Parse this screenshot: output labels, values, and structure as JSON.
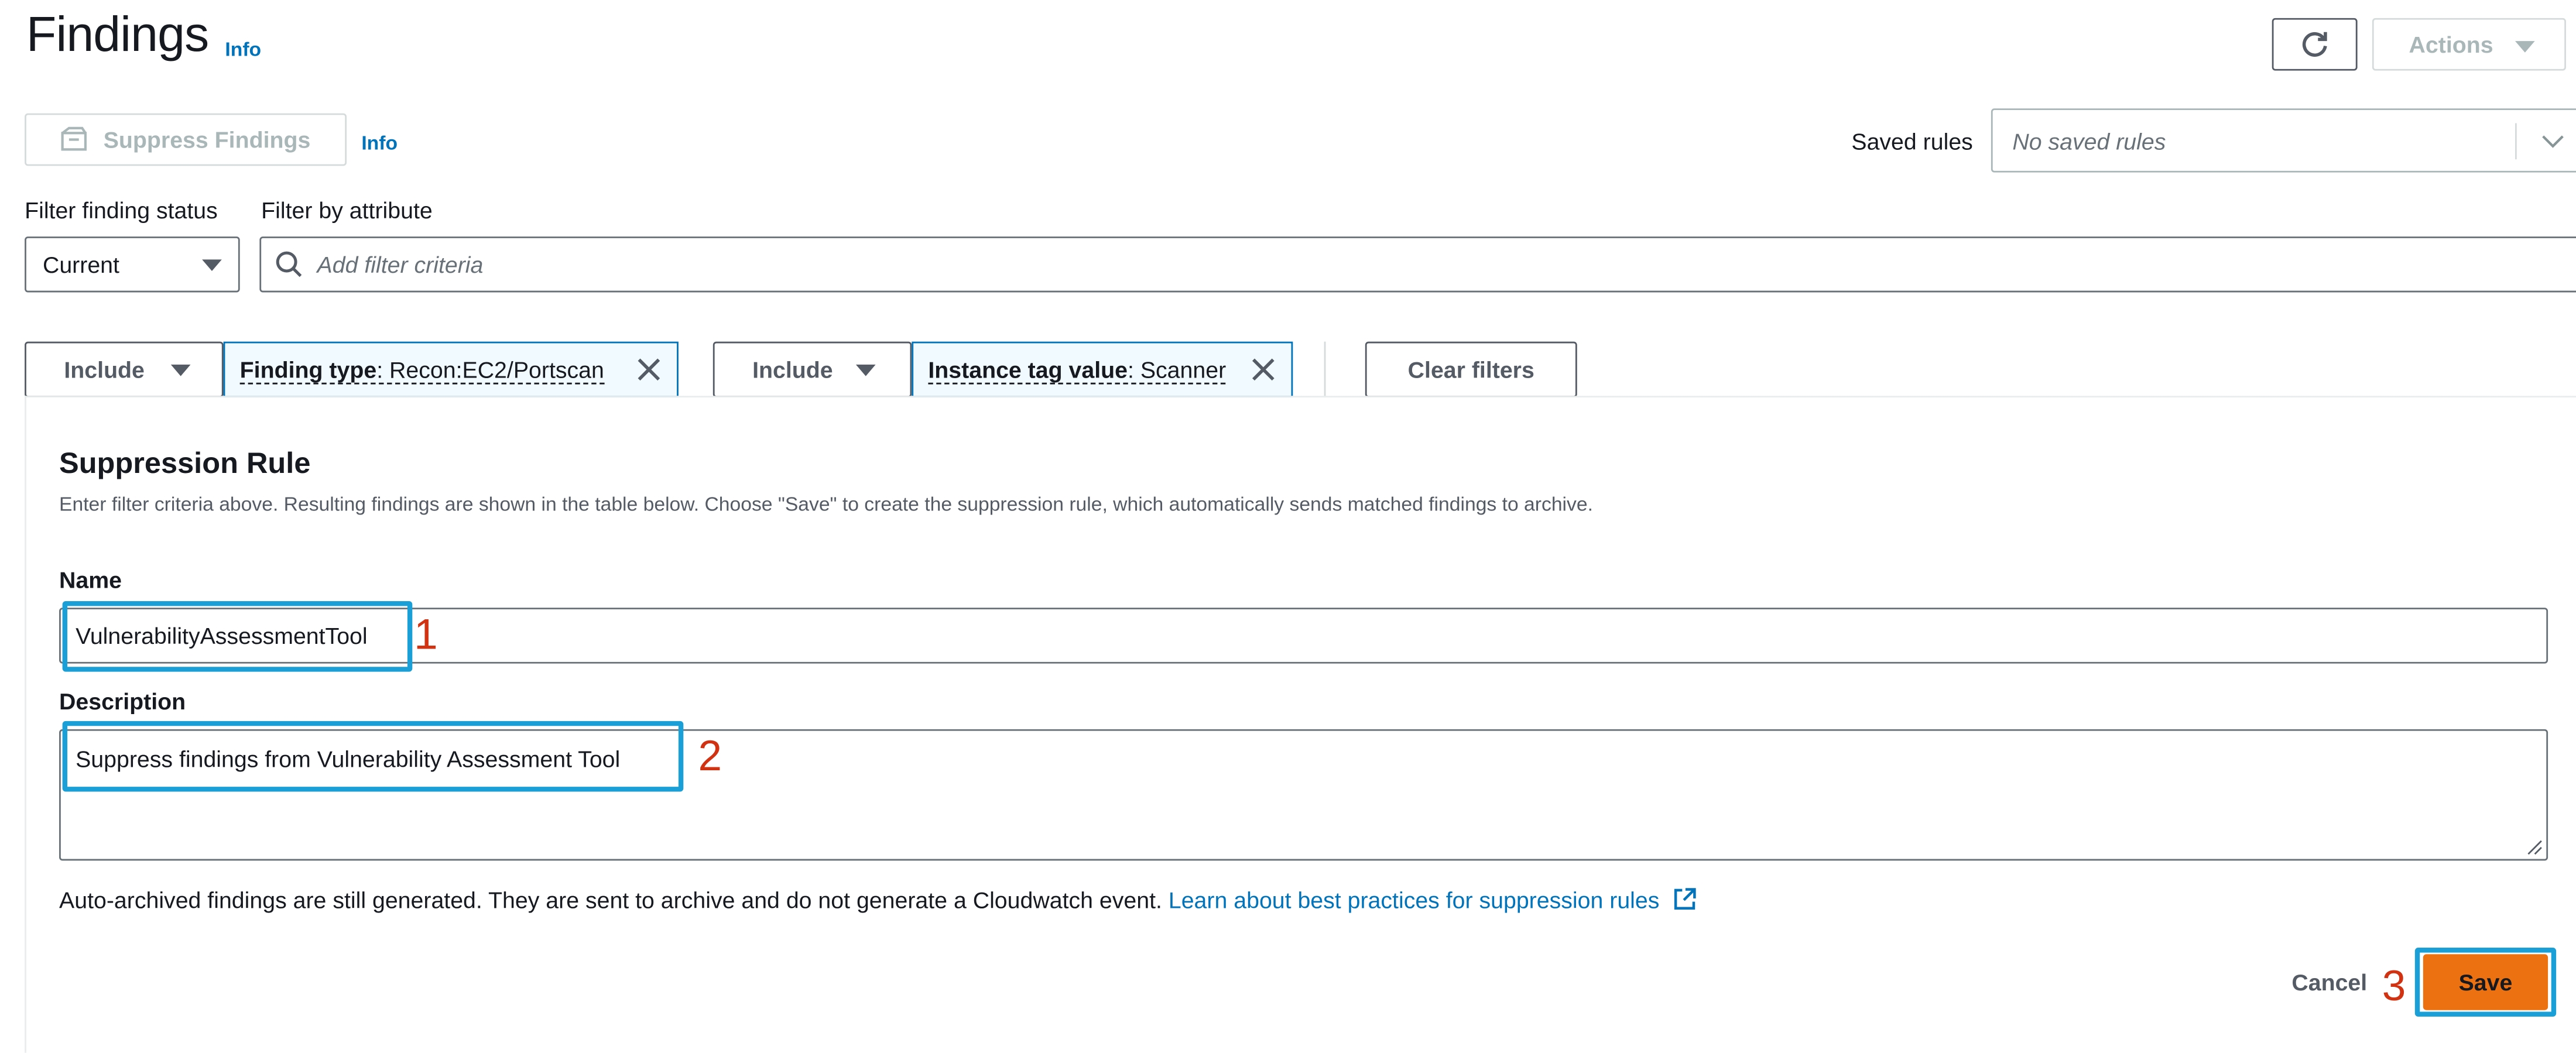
{
  "header": {
    "title": "Findings",
    "info": "Info",
    "actions_label": "Actions"
  },
  "toolbar": {
    "suppress_label": "Suppress Findings",
    "info": "Info",
    "saved_rules_label": "Saved rules",
    "saved_rules_placeholder": "No saved rules"
  },
  "filters": {
    "status_label": "Filter finding status",
    "status_value": "Current",
    "attribute_label": "Filter by attribute",
    "attribute_placeholder": "Add filter criteria",
    "tokens": [
      {
        "operator": "Include",
        "key": "Finding type",
        "value": ": Recon:EC2/Portscan"
      },
      {
        "operator": "Include",
        "key": "Instance tag value",
        "value": ": Scanner"
      }
    ],
    "clear_label": "Clear filters"
  },
  "rule": {
    "heading": "Suppression Rule",
    "description": "Enter filter criteria above. Resulting findings are shown in the table below. Choose \"Save\" to create the suppression rule, which automatically sends matched findings to archive.",
    "name_label": "Name",
    "name_value": "VulnerabilityAssessmentTool",
    "desc_label": "Description",
    "desc_value": "Suppress findings from Vulnerability Assessment Tool",
    "note": "Auto-archived findings are still generated. They are sent to archive and do not generate a Cloudwatch event.",
    "learn_link": "Learn about best practices for suppression rules",
    "cancel": "Cancel",
    "save": "Save"
  },
  "callouts": [
    "1",
    "2",
    "3"
  ],
  "colors": {
    "link": "#0073bb",
    "primary": "#ec7211",
    "highlight": "#1a9fd6",
    "callout": "#d13212"
  }
}
